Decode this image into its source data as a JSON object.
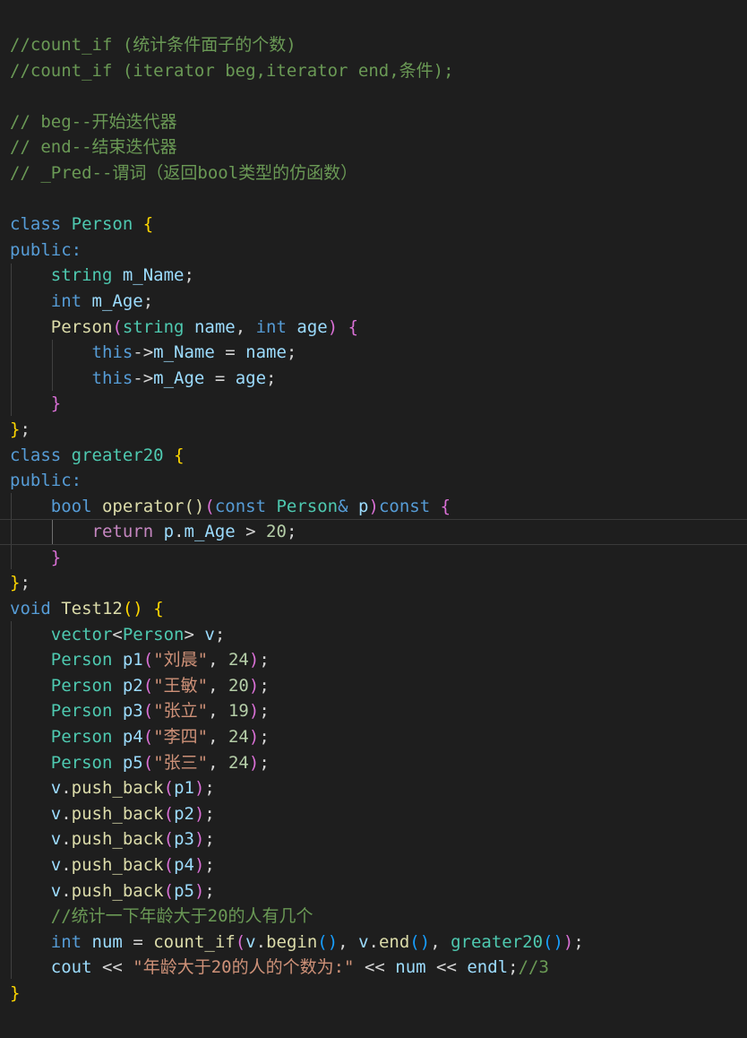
{
  "editor": {
    "theme": "dark",
    "colors": {
      "background": "#1e1e1e",
      "comment": "#6a9955",
      "keyword": "#569cd6",
      "control": "#c586c0",
      "type": "#4ec9b0",
      "function": "#dcdcaa",
      "variable": "#9cdcfe",
      "string": "#ce9178",
      "number": "#b5cea8",
      "bracket_level1": "#ffd700",
      "bracket_level2": "#da70d6",
      "bracket_level3": "#179fff"
    },
    "lines": [
      [
        {
          "t": "//count_if (统计条件面子的个数)",
          "c": "c"
        }
      ],
      [
        {
          "t": "//count_if (iterator beg,iterator end,条件);",
          "c": "c"
        }
      ],
      [],
      [
        {
          "t": "// beg--开始迭代器",
          "c": "c"
        }
      ],
      [
        {
          "t": "// end--结束迭代器",
          "c": "c"
        }
      ],
      [
        {
          "t": "// _Pred--谓词（返回bool类型的仿函数）",
          "c": "c"
        }
      ],
      [],
      [
        {
          "t": "class",
          "c": "kw"
        },
        {
          "t": " ",
          "c": "op"
        },
        {
          "t": "Person",
          "c": "ty"
        },
        {
          "t": " ",
          "c": "op"
        },
        {
          "t": "{",
          "c": "b1"
        }
      ],
      [
        {
          "t": "public:",
          "c": "kw"
        }
      ],
      [
        {
          "t": "    ",
          "c": "op"
        },
        {
          "t": "string",
          "c": "ty"
        },
        {
          "t": " ",
          "c": "op"
        },
        {
          "t": "m_Name",
          "c": "var"
        },
        {
          "t": ";",
          "c": "op"
        }
      ],
      [
        {
          "t": "    ",
          "c": "op"
        },
        {
          "t": "int",
          "c": "kw"
        },
        {
          "t": " ",
          "c": "op"
        },
        {
          "t": "m_Age",
          "c": "var"
        },
        {
          "t": ";",
          "c": "op"
        }
      ],
      [
        {
          "t": "    ",
          "c": "op"
        },
        {
          "t": "Person",
          "c": "fn"
        },
        {
          "t": "(",
          "c": "b2"
        },
        {
          "t": "string",
          "c": "ty"
        },
        {
          "t": " ",
          "c": "op"
        },
        {
          "t": "name",
          "c": "var"
        },
        {
          "t": ", ",
          "c": "op"
        },
        {
          "t": "int",
          "c": "kw"
        },
        {
          "t": " ",
          "c": "op"
        },
        {
          "t": "age",
          "c": "var"
        },
        {
          "t": ")",
          "c": "b2"
        },
        {
          "t": " ",
          "c": "op"
        },
        {
          "t": "{",
          "c": "b2"
        }
      ],
      [
        {
          "t": "        ",
          "c": "op"
        },
        {
          "t": "this",
          "c": "kw"
        },
        {
          "t": "->",
          "c": "op"
        },
        {
          "t": "m_Name",
          "c": "var"
        },
        {
          "t": " = ",
          "c": "op"
        },
        {
          "t": "name",
          "c": "var"
        },
        {
          "t": ";",
          "c": "op"
        }
      ],
      [
        {
          "t": "        ",
          "c": "op"
        },
        {
          "t": "this",
          "c": "kw"
        },
        {
          "t": "->",
          "c": "op"
        },
        {
          "t": "m_Age",
          "c": "var"
        },
        {
          "t": " = ",
          "c": "op"
        },
        {
          "t": "age",
          "c": "var"
        },
        {
          "t": ";",
          "c": "op"
        }
      ],
      [
        {
          "t": "    ",
          "c": "op"
        },
        {
          "t": "}",
          "c": "b2"
        }
      ],
      [
        {
          "t": "}",
          "c": "b1"
        },
        {
          "t": ";",
          "c": "op"
        }
      ],
      [
        {
          "t": "class",
          "c": "kw"
        },
        {
          "t": " ",
          "c": "op"
        },
        {
          "t": "greater20",
          "c": "ty"
        },
        {
          "t": " ",
          "c": "op"
        },
        {
          "t": "{",
          "c": "b1"
        }
      ],
      [
        {
          "t": "public:",
          "c": "kw"
        }
      ],
      [
        {
          "t": "    ",
          "c": "op"
        },
        {
          "t": "bool",
          "c": "kw"
        },
        {
          "t": " ",
          "c": "op"
        },
        {
          "t": "operator()",
          "c": "fn"
        },
        {
          "t": "(",
          "c": "b2"
        },
        {
          "t": "const",
          "c": "kw"
        },
        {
          "t": " ",
          "c": "op"
        },
        {
          "t": "Person",
          "c": "ty"
        },
        {
          "t": "&",
          "c": "kw"
        },
        {
          "t": " ",
          "c": "op"
        },
        {
          "t": "p",
          "c": "var"
        },
        {
          "t": ")",
          "c": "b2"
        },
        {
          "t": "const",
          "c": "kw"
        },
        {
          "t": " ",
          "c": "op"
        },
        {
          "t": "{",
          "c": "b2"
        }
      ],
      [
        {
          "t": "        ",
          "c": "op"
        },
        {
          "t": "return",
          "c": "ctl"
        },
        {
          "t": " ",
          "c": "op"
        },
        {
          "t": "p",
          "c": "var"
        },
        {
          "t": ".",
          "c": "op"
        },
        {
          "t": "m_Age",
          "c": "var"
        },
        {
          "t": " > ",
          "c": "op"
        },
        {
          "t": "20",
          "c": "num"
        },
        {
          "t": ";",
          "c": "op"
        }
      ],
      [
        {
          "t": "    ",
          "c": "op"
        },
        {
          "t": "}",
          "c": "b2"
        }
      ],
      [
        {
          "t": "}",
          "c": "b1"
        },
        {
          "t": ";",
          "c": "op"
        }
      ],
      [
        {
          "t": "void",
          "c": "kw"
        },
        {
          "t": " ",
          "c": "op"
        },
        {
          "t": "Test12",
          "c": "fn"
        },
        {
          "t": "()",
          "c": "b1"
        },
        {
          "t": " ",
          "c": "op"
        },
        {
          "t": "{",
          "c": "b1"
        }
      ],
      [
        {
          "t": "    ",
          "c": "op"
        },
        {
          "t": "vector",
          "c": "ty"
        },
        {
          "t": "<",
          "c": "op"
        },
        {
          "t": "Person",
          "c": "ty"
        },
        {
          "t": ">",
          "c": "op"
        },
        {
          "t": " ",
          "c": "op"
        },
        {
          "t": "v",
          "c": "var"
        },
        {
          "t": ";",
          "c": "op"
        }
      ],
      [
        {
          "t": "    ",
          "c": "op"
        },
        {
          "t": "Person",
          "c": "ty"
        },
        {
          "t": " ",
          "c": "op"
        },
        {
          "t": "p1",
          "c": "var"
        },
        {
          "t": "(",
          "c": "b2"
        },
        {
          "t": "\"刘晨\"",
          "c": "str"
        },
        {
          "t": ", ",
          "c": "op"
        },
        {
          "t": "24",
          "c": "num"
        },
        {
          "t": ")",
          "c": "b2"
        },
        {
          "t": ";",
          "c": "op"
        }
      ],
      [
        {
          "t": "    ",
          "c": "op"
        },
        {
          "t": "Person",
          "c": "ty"
        },
        {
          "t": " ",
          "c": "op"
        },
        {
          "t": "p2",
          "c": "var"
        },
        {
          "t": "(",
          "c": "b2"
        },
        {
          "t": "\"王敏\"",
          "c": "str"
        },
        {
          "t": ", ",
          "c": "op"
        },
        {
          "t": "20",
          "c": "num"
        },
        {
          "t": ")",
          "c": "b2"
        },
        {
          "t": ";",
          "c": "op"
        }
      ],
      [
        {
          "t": "    ",
          "c": "op"
        },
        {
          "t": "Person",
          "c": "ty"
        },
        {
          "t": " ",
          "c": "op"
        },
        {
          "t": "p3",
          "c": "var"
        },
        {
          "t": "(",
          "c": "b2"
        },
        {
          "t": "\"张立\"",
          "c": "str"
        },
        {
          "t": ", ",
          "c": "op"
        },
        {
          "t": "19",
          "c": "num"
        },
        {
          "t": ")",
          "c": "b2"
        },
        {
          "t": ";",
          "c": "op"
        }
      ],
      [
        {
          "t": "    ",
          "c": "op"
        },
        {
          "t": "Person",
          "c": "ty"
        },
        {
          "t": " ",
          "c": "op"
        },
        {
          "t": "p4",
          "c": "var"
        },
        {
          "t": "(",
          "c": "b2"
        },
        {
          "t": "\"李四\"",
          "c": "str"
        },
        {
          "t": ", ",
          "c": "op"
        },
        {
          "t": "24",
          "c": "num"
        },
        {
          "t": ")",
          "c": "b2"
        },
        {
          "t": ";",
          "c": "op"
        }
      ],
      [
        {
          "t": "    ",
          "c": "op"
        },
        {
          "t": "Person",
          "c": "ty"
        },
        {
          "t": " ",
          "c": "op"
        },
        {
          "t": "p5",
          "c": "var"
        },
        {
          "t": "(",
          "c": "b2"
        },
        {
          "t": "\"张三\"",
          "c": "str"
        },
        {
          "t": ", ",
          "c": "op"
        },
        {
          "t": "24",
          "c": "num"
        },
        {
          "t": ")",
          "c": "b2"
        },
        {
          "t": ";",
          "c": "op"
        }
      ],
      [
        {
          "t": "    ",
          "c": "op"
        },
        {
          "t": "v",
          "c": "var"
        },
        {
          "t": ".",
          "c": "op"
        },
        {
          "t": "push_back",
          "c": "fn"
        },
        {
          "t": "(",
          "c": "b2"
        },
        {
          "t": "p1",
          "c": "var"
        },
        {
          "t": ")",
          "c": "b2"
        },
        {
          "t": ";",
          "c": "op"
        }
      ],
      [
        {
          "t": "    ",
          "c": "op"
        },
        {
          "t": "v",
          "c": "var"
        },
        {
          "t": ".",
          "c": "op"
        },
        {
          "t": "push_back",
          "c": "fn"
        },
        {
          "t": "(",
          "c": "b2"
        },
        {
          "t": "p2",
          "c": "var"
        },
        {
          "t": ")",
          "c": "b2"
        },
        {
          "t": ";",
          "c": "op"
        }
      ],
      [
        {
          "t": "    ",
          "c": "op"
        },
        {
          "t": "v",
          "c": "var"
        },
        {
          "t": ".",
          "c": "op"
        },
        {
          "t": "push_back",
          "c": "fn"
        },
        {
          "t": "(",
          "c": "b2"
        },
        {
          "t": "p3",
          "c": "var"
        },
        {
          "t": ")",
          "c": "b2"
        },
        {
          "t": ";",
          "c": "op"
        }
      ],
      [
        {
          "t": "    ",
          "c": "op"
        },
        {
          "t": "v",
          "c": "var"
        },
        {
          "t": ".",
          "c": "op"
        },
        {
          "t": "push_back",
          "c": "fn"
        },
        {
          "t": "(",
          "c": "b2"
        },
        {
          "t": "p4",
          "c": "var"
        },
        {
          "t": ")",
          "c": "b2"
        },
        {
          "t": ";",
          "c": "op"
        }
      ],
      [
        {
          "t": "    ",
          "c": "op"
        },
        {
          "t": "v",
          "c": "var"
        },
        {
          "t": ".",
          "c": "op"
        },
        {
          "t": "push_back",
          "c": "fn"
        },
        {
          "t": "(",
          "c": "b2"
        },
        {
          "t": "p5",
          "c": "var"
        },
        {
          "t": ")",
          "c": "b2"
        },
        {
          "t": ";",
          "c": "op"
        }
      ],
      [
        {
          "t": "    ",
          "c": "op"
        },
        {
          "t": "//统计一下年龄大于20的人有几个",
          "c": "c"
        }
      ],
      [
        {
          "t": "    ",
          "c": "op"
        },
        {
          "t": "int",
          "c": "kw"
        },
        {
          "t": " ",
          "c": "op"
        },
        {
          "t": "num",
          "c": "var"
        },
        {
          "t": " = ",
          "c": "op"
        },
        {
          "t": "count_if",
          "c": "fn"
        },
        {
          "t": "(",
          "c": "b2"
        },
        {
          "t": "v",
          "c": "var"
        },
        {
          "t": ".",
          "c": "op"
        },
        {
          "t": "begin",
          "c": "fn"
        },
        {
          "t": "()",
          "c": "b3"
        },
        {
          "t": ", ",
          "c": "op"
        },
        {
          "t": "v",
          "c": "var"
        },
        {
          "t": ".",
          "c": "op"
        },
        {
          "t": "end",
          "c": "fn"
        },
        {
          "t": "()",
          "c": "b3"
        },
        {
          "t": ", ",
          "c": "op"
        },
        {
          "t": "greater20",
          "c": "ty"
        },
        {
          "t": "()",
          "c": "b3"
        },
        {
          "t": ")",
          "c": "b2"
        },
        {
          "t": ";",
          "c": "op"
        }
      ],
      [
        {
          "t": "    ",
          "c": "op"
        },
        {
          "t": "cout",
          "c": "var"
        },
        {
          "t": " << ",
          "c": "op"
        },
        {
          "t": "\"年龄大于20的人的个数为:\"",
          "c": "str"
        },
        {
          "t": " << ",
          "c": "op"
        },
        {
          "t": "num",
          "c": "var"
        },
        {
          "t": " << ",
          "c": "op"
        },
        {
          "t": "endl",
          "c": "var"
        },
        {
          "t": ";",
          "c": "op"
        },
        {
          "t": "//3",
          "c": "c"
        }
      ],
      [
        {
          "t": "}",
          "c": "b1"
        }
      ]
    ]
  }
}
